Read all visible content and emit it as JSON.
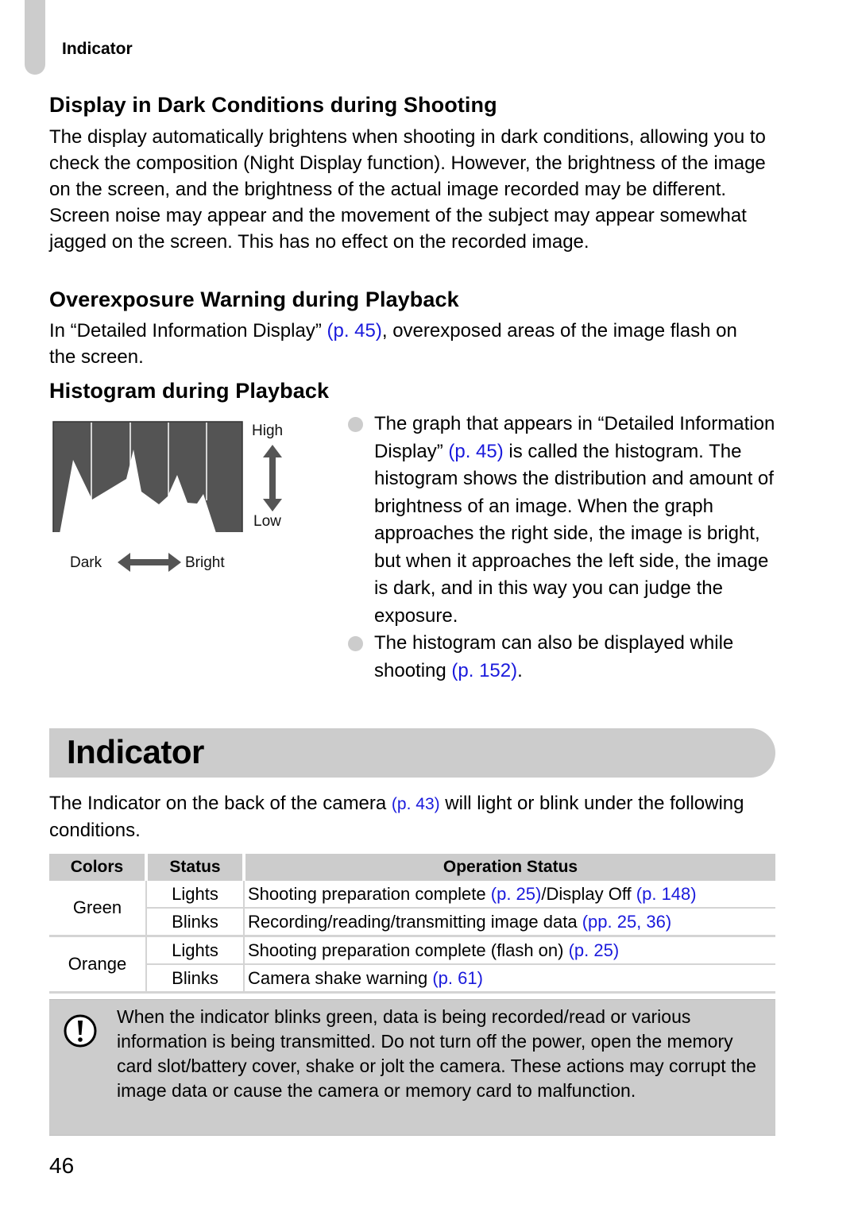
{
  "running_head": "Indicator",
  "sections": {
    "dark_display": {
      "heading": "Display in Dark Conditions during Shooting",
      "body": "The display automatically brightens when shooting in dark conditions, allowing you to check the composition (Night Display function). However, the brightness of the image on the screen, and the brightness of the actual image recorded may be different. Screen noise may appear and the movement of the subject may appear somewhat jagged on the screen. This has no effect on the recorded image."
    },
    "overexposure": {
      "heading": "Overexposure Warning during Playback",
      "body_before": "In “Detailed Information Display” ",
      "link": "(p. 45)",
      "body_after": ", overexposed areas of the image flash on the screen."
    },
    "histogram": {
      "heading": "Histogram during Playback",
      "labels": {
        "high": "High",
        "low": "Low",
        "dark": "Dark",
        "bright": "Bright"
      },
      "bullets": [
        {
          "before": "The graph that appears in “Detailed Information Display” ",
          "link": "(p. 45)",
          "after": " is called the histogram. The histogram shows the distribution and amount of brightness of an image. When the graph approaches the right side, the image is bright, but when it approaches the left side, the image is dark, and in this way you can judge the exposure."
        },
        {
          "before": "The histogram can also be displayed while shooting ",
          "link": "(p. 152)",
          "after": "."
        }
      ]
    }
  },
  "indicator": {
    "title": "Indicator",
    "intro_before": "The Indicator on the back of the camera ",
    "intro_link": "(p. 43)",
    "intro_after": " will light or blink under the following conditions.",
    "table": {
      "headers": [
        "Colors",
        "Status",
        "Operation Status"
      ],
      "groups": [
        {
          "color": "Green",
          "rows": [
            {
              "status": "Lights",
              "op_parts": [
                {
                  "text": "Shooting preparation complete ",
                  "link": false
                },
                {
                  "text": "(p. 25)",
                  "link": true
                },
                {
                  "text": "/Display Off ",
                  "link": false
                },
                {
                  "text": "(p. 148)",
                  "link": true
                }
              ]
            },
            {
              "status": "Blinks",
              "op_parts": [
                {
                  "text": "Recording/reading/transmitting image data ",
                  "link": false
                },
                {
                  "text": "(pp. 25, 36)",
                  "link": true
                }
              ]
            }
          ]
        },
        {
          "color": "Orange",
          "rows": [
            {
              "status": "Lights",
              "op_parts": [
                {
                  "text": "Shooting preparation complete (flash on) ",
                  "link": false
                },
                {
                  "text": "(p. 25)",
                  "link": true
                }
              ]
            },
            {
              "status": "Blinks",
              "op_parts": [
                {
                  "text": "Camera shake warning ",
                  "link": false
                },
                {
                  "text": "(p. 61)",
                  "link": true
                }
              ]
            }
          ]
        }
      ]
    },
    "caution": {
      "icon": "caution-exclamation-icon",
      "text": "When the indicator blinks green, data is being recorded/read or various information is being transmitted. Do not turn off the power, open the memory card slot/battery cover, shake or jolt the camera. These actions may corrupt the image data or cause the camera or memory card to malfunction."
    }
  },
  "page_number": "46",
  "colors": {
    "link": "#1a1adc",
    "accent_gray": "#cccccc",
    "histogram_bg": "#545454"
  }
}
